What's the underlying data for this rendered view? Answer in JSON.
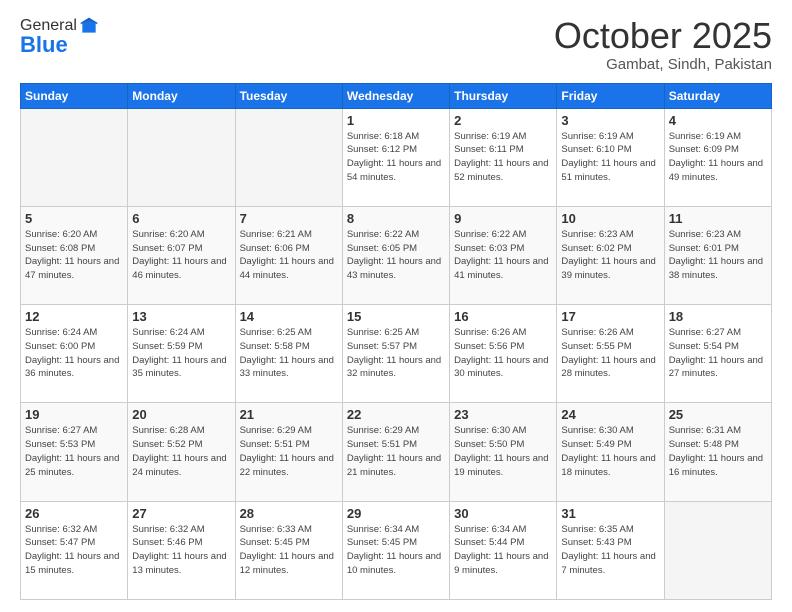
{
  "header": {
    "logo_general": "General",
    "logo_blue": "Blue",
    "month": "October 2025",
    "location": "Gambat, Sindh, Pakistan"
  },
  "days_of_week": [
    "Sunday",
    "Monday",
    "Tuesday",
    "Wednesday",
    "Thursday",
    "Friday",
    "Saturday"
  ],
  "weeks": [
    [
      {
        "day": "",
        "info": ""
      },
      {
        "day": "",
        "info": ""
      },
      {
        "day": "",
        "info": ""
      },
      {
        "day": "1",
        "info": "Sunrise: 6:18 AM\nSunset: 6:12 PM\nDaylight: 11 hours\nand 54 minutes."
      },
      {
        "day": "2",
        "info": "Sunrise: 6:19 AM\nSunset: 6:11 PM\nDaylight: 11 hours\nand 52 minutes."
      },
      {
        "day": "3",
        "info": "Sunrise: 6:19 AM\nSunset: 6:10 PM\nDaylight: 11 hours\nand 51 minutes."
      },
      {
        "day": "4",
        "info": "Sunrise: 6:19 AM\nSunset: 6:09 PM\nDaylight: 11 hours\nand 49 minutes."
      }
    ],
    [
      {
        "day": "5",
        "info": "Sunrise: 6:20 AM\nSunset: 6:08 PM\nDaylight: 11 hours\nand 47 minutes."
      },
      {
        "day": "6",
        "info": "Sunrise: 6:20 AM\nSunset: 6:07 PM\nDaylight: 11 hours\nand 46 minutes."
      },
      {
        "day": "7",
        "info": "Sunrise: 6:21 AM\nSunset: 6:06 PM\nDaylight: 11 hours\nand 44 minutes."
      },
      {
        "day": "8",
        "info": "Sunrise: 6:22 AM\nSunset: 6:05 PM\nDaylight: 11 hours\nand 43 minutes."
      },
      {
        "day": "9",
        "info": "Sunrise: 6:22 AM\nSunset: 6:03 PM\nDaylight: 11 hours\nand 41 minutes."
      },
      {
        "day": "10",
        "info": "Sunrise: 6:23 AM\nSunset: 6:02 PM\nDaylight: 11 hours\nand 39 minutes."
      },
      {
        "day": "11",
        "info": "Sunrise: 6:23 AM\nSunset: 6:01 PM\nDaylight: 11 hours\nand 38 minutes."
      }
    ],
    [
      {
        "day": "12",
        "info": "Sunrise: 6:24 AM\nSunset: 6:00 PM\nDaylight: 11 hours\nand 36 minutes."
      },
      {
        "day": "13",
        "info": "Sunrise: 6:24 AM\nSunset: 5:59 PM\nDaylight: 11 hours\nand 35 minutes."
      },
      {
        "day": "14",
        "info": "Sunrise: 6:25 AM\nSunset: 5:58 PM\nDaylight: 11 hours\nand 33 minutes."
      },
      {
        "day": "15",
        "info": "Sunrise: 6:25 AM\nSunset: 5:57 PM\nDaylight: 11 hours\nand 32 minutes."
      },
      {
        "day": "16",
        "info": "Sunrise: 6:26 AM\nSunset: 5:56 PM\nDaylight: 11 hours\nand 30 minutes."
      },
      {
        "day": "17",
        "info": "Sunrise: 6:26 AM\nSunset: 5:55 PM\nDaylight: 11 hours\nand 28 minutes."
      },
      {
        "day": "18",
        "info": "Sunrise: 6:27 AM\nSunset: 5:54 PM\nDaylight: 11 hours\nand 27 minutes."
      }
    ],
    [
      {
        "day": "19",
        "info": "Sunrise: 6:27 AM\nSunset: 5:53 PM\nDaylight: 11 hours\nand 25 minutes."
      },
      {
        "day": "20",
        "info": "Sunrise: 6:28 AM\nSunset: 5:52 PM\nDaylight: 11 hours\nand 24 minutes."
      },
      {
        "day": "21",
        "info": "Sunrise: 6:29 AM\nSunset: 5:51 PM\nDaylight: 11 hours\nand 22 minutes."
      },
      {
        "day": "22",
        "info": "Sunrise: 6:29 AM\nSunset: 5:51 PM\nDaylight: 11 hours\nand 21 minutes."
      },
      {
        "day": "23",
        "info": "Sunrise: 6:30 AM\nSunset: 5:50 PM\nDaylight: 11 hours\nand 19 minutes."
      },
      {
        "day": "24",
        "info": "Sunrise: 6:30 AM\nSunset: 5:49 PM\nDaylight: 11 hours\nand 18 minutes."
      },
      {
        "day": "25",
        "info": "Sunrise: 6:31 AM\nSunset: 5:48 PM\nDaylight: 11 hours\nand 16 minutes."
      }
    ],
    [
      {
        "day": "26",
        "info": "Sunrise: 6:32 AM\nSunset: 5:47 PM\nDaylight: 11 hours\nand 15 minutes."
      },
      {
        "day": "27",
        "info": "Sunrise: 6:32 AM\nSunset: 5:46 PM\nDaylight: 11 hours\nand 13 minutes."
      },
      {
        "day": "28",
        "info": "Sunrise: 6:33 AM\nSunset: 5:45 PM\nDaylight: 11 hours\nand 12 minutes."
      },
      {
        "day": "29",
        "info": "Sunrise: 6:34 AM\nSunset: 5:45 PM\nDaylight: 11 hours\nand 10 minutes."
      },
      {
        "day": "30",
        "info": "Sunrise: 6:34 AM\nSunset: 5:44 PM\nDaylight: 11 hours\nand 9 minutes."
      },
      {
        "day": "31",
        "info": "Sunrise: 6:35 AM\nSunset: 5:43 PM\nDaylight: 11 hours\nand 7 minutes."
      },
      {
        "day": "",
        "info": ""
      }
    ]
  ]
}
